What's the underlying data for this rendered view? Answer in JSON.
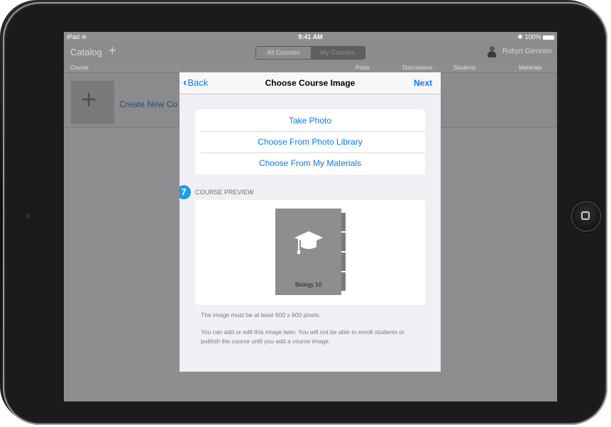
{
  "status": {
    "device": "iPad",
    "time": "9:41 AM",
    "battery": "100%"
  },
  "nav": {
    "catalog": "Catalog",
    "segments": [
      "All Courses",
      "My Courses"
    ],
    "user": "Robyn Glennon"
  },
  "columns": {
    "course": "Course",
    "posts": "Posts",
    "discussions": "Discussions",
    "students": "Students",
    "materials": "Materials"
  },
  "row": {
    "create": "Create New Co"
  },
  "modal": {
    "back": "Back",
    "title": "Choose Course Image",
    "next": "Next",
    "options": [
      "Take Photo",
      "Choose From Photo Library",
      "Choose From My Materials"
    ],
    "badge": "7",
    "section": "COURSE PREVIEW",
    "book_label": "Biology 10",
    "note1": "The image must be at least 600 x 600 pixels.",
    "note2": "You can add or edit this image later. You will not be able to enroll students or publish the course until you add a course image."
  }
}
